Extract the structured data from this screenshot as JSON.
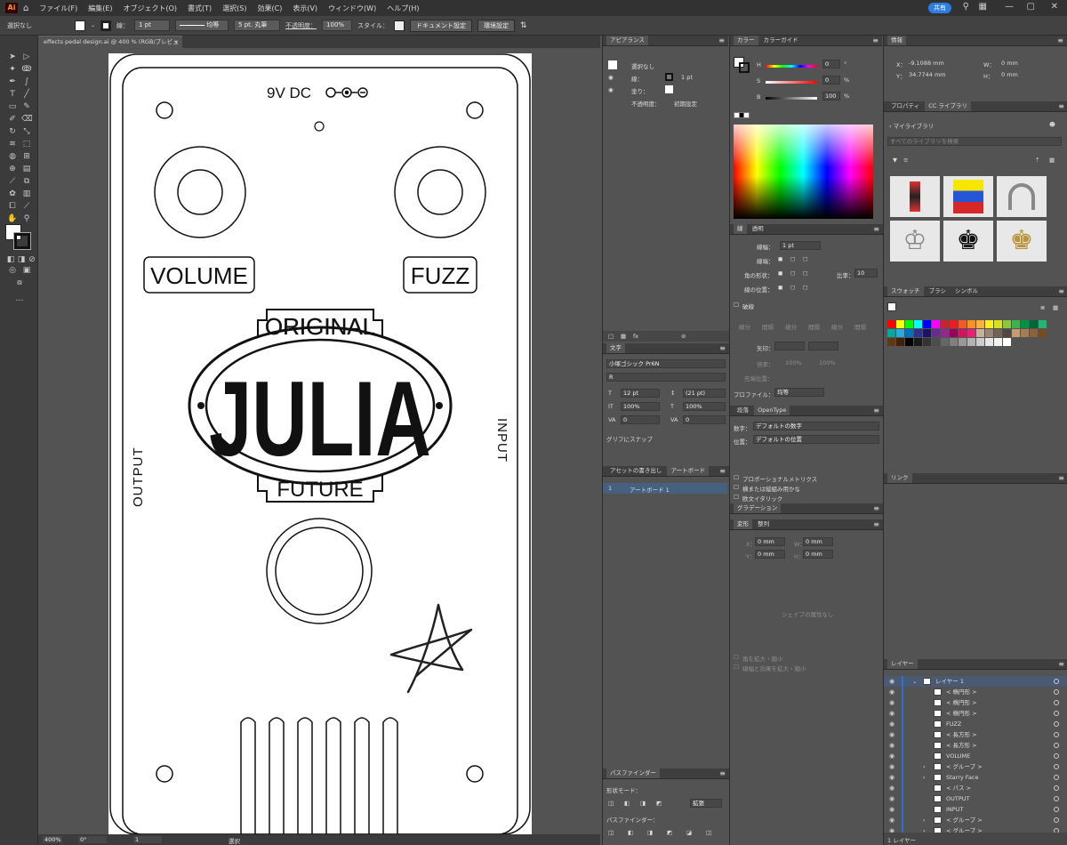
{
  "menubar": {
    "logo": "Ai",
    "items": [
      "ファイル(F)",
      "編集(E)",
      "オブジェクト(O)",
      "書式(T)",
      "選択(S)",
      "効果(C)",
      "表示(V)",
      "ウィンドウ(W)",
      "ヘルプ(H)"
    ],
    "share_label": "共有"
  },
  "controlbar": {
    "selection": "選択なし",
    "stroke_label": "線：",
    "stroke_value": "1 pt",
    "stroke_style": "均等",
    "brush": "5 pt. 丸筆",
    "opacity_label": "不透明度：",
    "opacity_value": "100%",
    "style_label": "スタイル：",
    "doc_settings": "ドキュメント設定",
    "prefs": "環境設定"
  },
  "document": {
    "tab_title": "effects pedal design.ai @ 400 % (RGB/プレビュー)"
  },
  "artwork": {
    "dc_label": "9V DC",
    "volume": "VOLUME",
    "fuzz": "FUZZ",
    "original": "ORIGINAL",
    "julia": "JULIA",
    "future": "FUTURE",
    "output": "OUTPUT",
    "input": "INPUT"
  },
  "statusbar": {
    "zoom": "400%",
    "rotate": "0°",
    "artboard": "1",
    "tool": "選択"
  },
  "appearance": {
    "title": "アピアランス",
    "selection": "選択なし",
    "stroke_label": "線：",
    "stroke_value": "1 pt",
    "fill_label": "塗り：",
    "opacity_label": "不透明度：",
    "opacity_value": "初期設定"
  },
  "character": {
    "title": "文字",
    "font": "小塚ゴシック Pr6N",
    "style": "R",
    "size": "12 pt",
    "leading": "(21 pt)",
    "hscale": "100%",
    "vscale": "100%",
    "tracking": "0",
    "kerning": "0",
    "snap_label": "グリフにスナップ"
  },
  "artboards": {
    "tab1": "アセットの書き出し",
    "tab2": "アートボード",
    "row_num": "1",
    "row_name": "アートボード 1"
  },
  "pathfinder": {
    "title": "パスファインダー",
    "shape_modes": "形状モード：",
    "expand": "拡張",
    "pathfinders": "パスファインダー："
  },
  "color": {
    "tab1": "カラー",
    "tab2": "カラーガイド",
    "h_label": "H",
    "h_value": "0",
    "s_label": "S",
    "s_value": "0",
    "b_label": "B",
    "b_value": "100",
    "deg": "°",
    "pct": "%"
  },
  "stroke_panel": {
    "tab1": "線",
    "tab2": "透明",
    "weight_label": "線幅：",
    "weight_value": "1 pt",
    "cap_label": "線端：",
    "corner_label": "角の形状：",
    "limit_label": "比率：",
    "limit_value": "10",
    "align_label": "線の位置：",
    "dashed": "破線",
    "dash_cells": [
      "線分",
      "間隔",
      "線分",
      "間隔",
      "線分",
      "間隔"
    ],
    "arrow_label": "矢印：",
    "scale_label": "倍率：",
    "scale1": "100%",
    "scale2": "100%",
    "arrow_pos": "先端位置：",
    "profile_label": "プロファイル：",
    "profile_value": "均等"
  },
  "opentype": {
    "tab1": "段落",
    "tab2": "OpenType",
    "figure_label": "数字：",
    "figure_value": "デフォルトの数字",
    "position_label": "位置：",
    "position_value": "デフォルトの位置",
    "opt1": "プロポーショナルメトリクス",
    "opt2": "横または縦組み用かな",
    "opt3": "欧文イタリック"
  },
  "gradient": {
    "title": "グラデーション"
  },
  "transform": {
    "tab1": "変形",
    "tab2": "整列",
    "x_label": "X：",
    "y_label": "Y：",
    "w_label": "W：",
    "h_label": "H：",
    "zero": "0 mm",
    "empty_note": "シェイプの属性なし",
    "chk1": "角を拡大・縮小",
    "chk2": "線幅と効果を拡大・縮小"
  },
  "info": {
    "title": "情報",
    "x_label": "X：",
    "x_value": "-9.1088 mm",
    "y_label": "Y：",
    "y_value": "34.7744 mm",
    "w_label": "W：",
    "w_value": "0 mm",
    "h_label": "H：",
    "h_value": "0 mm"
  },
  "libraries": {
    "tab1": "プロパティ",
    "tab2": "CC ライブラリ",
    "name": "マイライブラリ",
    "search_placeholder": "すべてのライブラリを検索"
  },
  "swatches": {
    "tab1": "スウォッチ",
    "tab2": "ブラシ",
    "tab3": "シンボル",
    "colors": [
      "#ff0000",
      "#ffff00",
      "#00ff00",
      "#00ffff",
      "#0000ff",
      "#ff00ff",
      "#c1272d",
      "#ed1c24",
      "#f15a24",
      "#f7931e",
      "#fbb03b",
      "#fcee21",
      "#d9e021",
      "#8cc63f",
      "#39b54a",
      "#009245",
      "#006837",
      "#22b573",
      "#00a99d",
      "#29abe2",
      "#0071bc",
      "#2e3192",
      "#1b1464",
      "#662d91",
      "#93278f",
      "#9e005d",
      "#d4145a",
      "#ed1e79",
      "#c7b299",
      "#998675",
      "#736357",
      "#534741",
      "#c69c6d",
      "#a67c52",
      "#8c6239",
      "#754c24",
      "#603813",
      "#42210b",
      "#000000",
      "#1a1a1a",
      "#333333",
      "#4d4d4d",
      "#666666",
      "#808080",
      "#999999",
      "#b3b3b3",
      "#cccccc",
      "#e6e6e6",
      "#f2f2f2",
      "#ffffff"
    ]
  },
  "links": {
    "title": "リンク"
  },
  "layers": {
    "title": "レイヤー",
    "layer_name": "レイヤー 1",
    "items": [
      "< 楕円形 >",
      "< 楕円形 >",
      "< 楕円形 >",
      "FUZZ",
      "< 長方形 >",
      "< 長方形 >",
      "VOLUME",
      "< グループ >",
      "Starry Face",
      "< パス >",
      "OUTPUT",
      "INPUT",
      "< グループ >",
      "< グループ >"
    ],
    "footer": "1 レイヤー"
  }
}
